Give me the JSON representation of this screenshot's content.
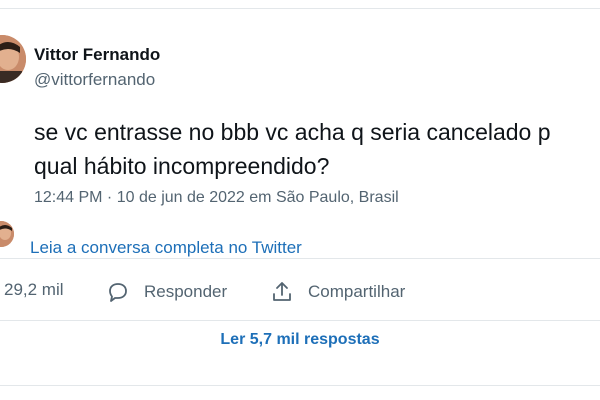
{
  "tweet": {
    "author_name": "Vittor Fernando",
    "author_handle": "@vittorfernando",
    "text_lines": [
      "se vc entrasse no bbb vc acha q seria cancelado p",
      "qual hábito incompreendido?"
    ],
    "timestamp": "12:44 PM · 10 de jun de 2022 em São Paulo, Brasil"
  },
  "read_conversation": "Leia a conversa completa no Twitter",
  "actions": {
    "likes_count": "29,2 mil",
    "reply_label": "Responder",
    "share_label": "Compartilhar"
  },
  "read_replies": "Ler 5,7 mil respostas",
  "colors": {
    "link": "#1d6fb8",
    "secondary_text": "#536471",
    "border": "#e3e7ea"
  }
}
